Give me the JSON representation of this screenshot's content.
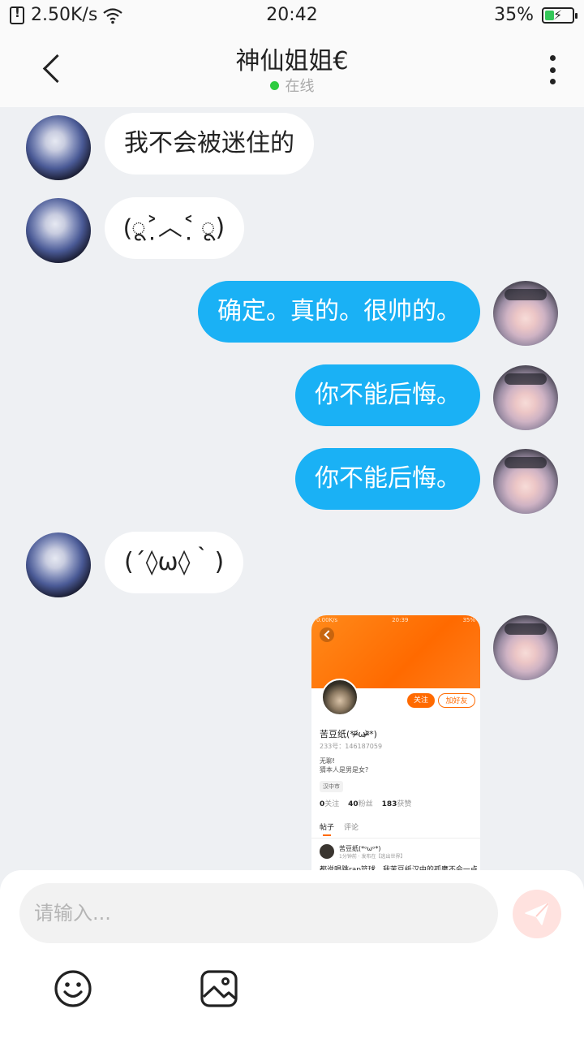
{
  "status_bar": {
    "net_speed": "2.50K/s",
    "time": "20:42",
    "battery_pct": "35%",
    "battery_level": 0.35
  },
  "header": {
    "title": "神仙姐姐€",
    "status": "在线"
  },
  "messages": [
    {
      "sender": "other",
      "text": "我不会被迷住的"
    },
    {
      "sender": "other",
      "text": "(ू˃̣̣̣̣̣̣︿˂̣̣̣̣̣̣ ू)"
    },
    {
      "sender": "me",
      "text": "确定。真的。很帅的。"
    },
    {
      "sender": "me",
      "text": "你不能后悔。"
    },
    {
      "sender": "me",
      "text": "你不能后悔。"
    },
    {
      "sender": "other",
      "text": "(´◊ω◊｀)"
    },
    {
      "sender": "me",
      "type": "image"
    }
  ],
  "shared_image": {
    "status_left": "0.00K/s",
    "status_time": "20:39",
    "status_right": "35%",
    "follow_label": "关注",
    "add_friend_label": "加好友",
    "name": "苦豆纸(*ᵒ̴̶̷᷄ωᵒ̴̶̷᷅*)",
    "id_line": "233号：146187059",
    "bio_line1": "无聊!",
    "bio_line2": "猜本人是男是女?",
    "tag": "汉中市",
    "follow_count": "0",
    "follow_label2": "关注",
    "fans_count": "40",
    "fans_label": "粉丝",
    "likes_count": "183",
    "likes_label": "获赞",
    "tab_posts": "帖子",
    "tab_comments": "评论",
    "post_name": "苦豆纸(*ᵒωᵒ*)",
    "post_meta": "1分钟前 · 发布在【逃出世界】",
    "post_text": "都说唱跳rap篮球，我苦豆纸汉中的孤鹰不会一点"
  },
  "input": {
    "placeholder": "请输入..."
  },
  "icons": {
    "back": "chevron-left-icon",
    "more": "more-vertical-icon",
    "send": "send-icon",
    "emoji": "emoji-icon",
    "image": "image-icon"
  },
  "colors": {
    "my_bubble": "#1ab1f5",
    "other_bubble": "#ffffff",
    "background": "#eef0f3",
    "online_dot": "#2ecc40",
    "accent_orange": "#ff6a00"
  }
}
